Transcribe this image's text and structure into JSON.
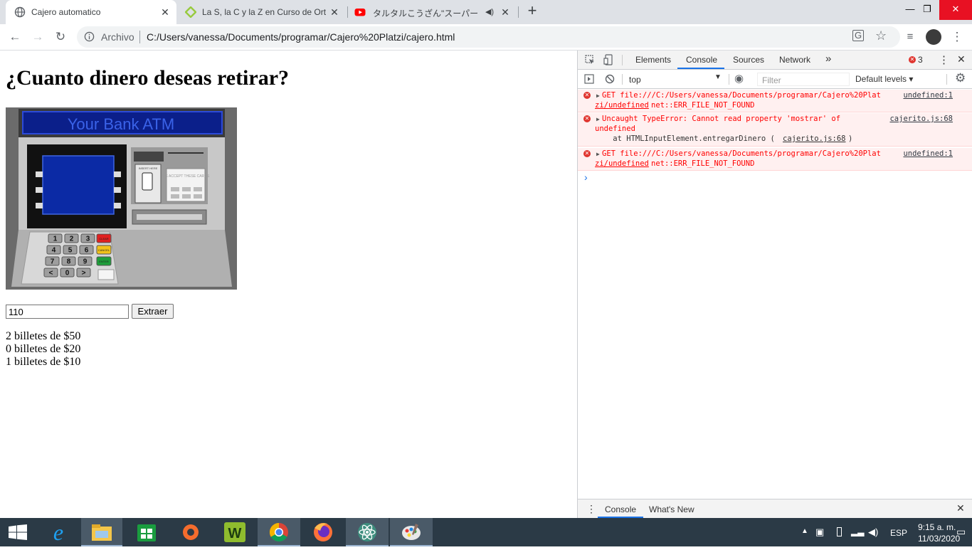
{
  "browser": {
    "tabs": [
      {
        "title": "Cajero automatico",
        "favicon": "globe-icon",
        "active": true
      },
      {
        "title": "La S, la C y la Z en Curso de Ortog",
        "favicon": "platzi-icon",
        "active": false
      },
      {
        "title": "タルタルこうざん\"スーパードンキー",
        "favicon": "youtube-icon",
        "active": false
      }
    ],
    "new_tab_label": "+",
    "address": {
      "scheme_label": "Archivo",
      "url": "C:/Users/vanessa/Documents/programar/Cajero%20Platzi/cajero.html"
    }
  },
  "page": {
    "heading": "¿Cuanto dinero deseas retirar?",
    "atm": {
      "brand": "Your Bank ATM",
      "insert_label": "INSERT HERE",
      "cards_label": "WE ACCEPT THESE CARDS",
      "keys": [
        "1",
        "2",
        "3",
        "4",
        "5",
        "6",
        "7",
        "8",
        "9",
        "<",
        "0",
        ">"
      ],
      "side_keys": [
        "CLEAR",
        "CANCEL",
        "ENTER"
      ]
    },
    "amount_input": {
      "value": "110"
    },
    "extract_button": "Extraer",
    "results": [
      "2 billetes de $50",
      "0 billetes de $20",
      "1 billetes de $10"
    ]
  },
  "devtools": {
    "tabs": [
      "Elements",
      "Console",
      "Sources",
      "Network"
    ],
    "active_tab": "Console",
    "more": "»",
    "error_count": "3",
    "context": "top",
    "filter_placeholder": "Filter",
    "levels": "Default levels ▾",
    "messages": [
      {
        "line1": "GET file:///C:/Users/vanessa/Documents/programar/Cajero%20Plat",
        "line2_link": "zi/undefined",
        "line2_rest": " net::ERR_FILE_NOT_FOUND",
        "source": "undefined:1"
      },
      {
        "line1": "Uncaught TypeError: Cannot read property 'mostrar' of",
        "line2": "undefined",
        "line3_pre": "    at HTMLInputElement.entregarDinero (",
        "line3_link": "cajerito.js:68",
        "line3_post": ")",
        "source": "cajerito.js:68"
      },
      {
        "line1": "GET file:///C:/Users/vanessa/Documents/programar/Cajero%20Plat",
        "line2_link": "zi/undefined",
        "line2_rest": " net::ERR_FILE_NOT_FOUND",
        "source": "undefined:1"
      }
    ],
    "prompt": "›",
    "drawer_tabs": [
      "Console",
      "What's New"
    ]
  },
  "taskbar": {
    "lang": "ESP",
    "time": "9:15 a. m.",
    "date": "11/03/2020"
  },
  "colors": {
    "tabstrip": "#dee1e6",
    "error_bg": "#fff0f0",
    "taskbar": "#2b3a46",
    "atm_screen": "#0b2aa5"
  }
}
